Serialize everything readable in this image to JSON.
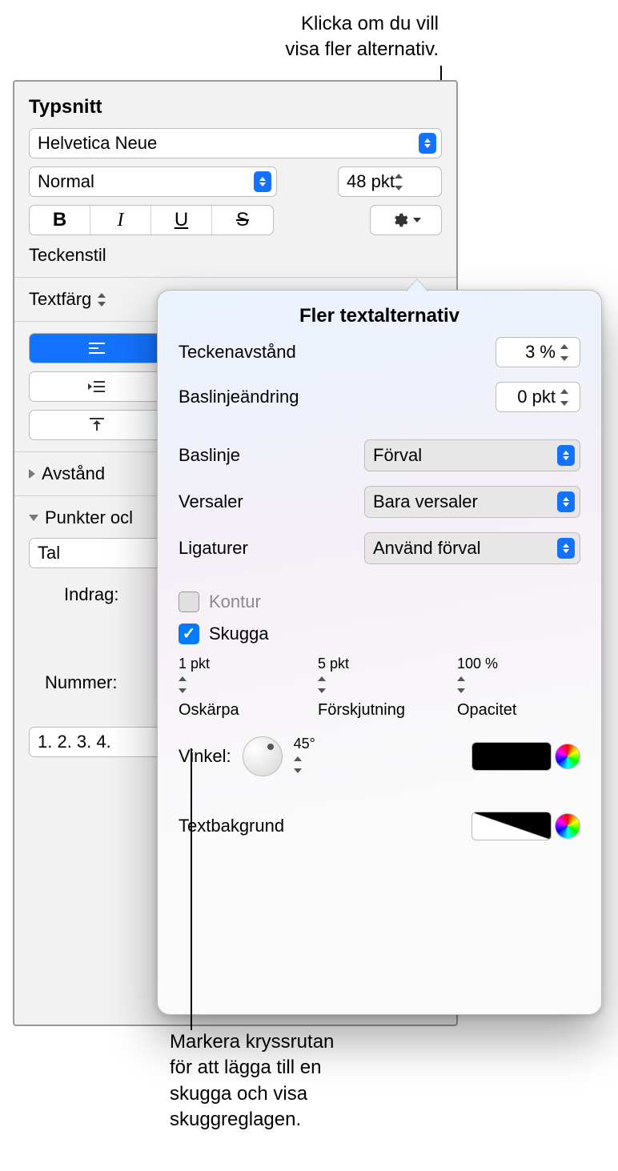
{
  "callouts": {
    "top": "Klicka om du vill\nvisa fler alternativ.",
    "bottom": "Markera kryssrutan\nför att lägga till en\nskugga och visa\nskuggreglagen."
  },
  "font": {
    "section_title": "Typsnitt",
    "family": "Helvetica Neue",
    "typeface": "Normal",
    "size": "48 pkt",
    "style_buttons": {
      "bold": "B",
      "italic": "I",
      "underline": "U",
      "strike": "S"
    }
  },
  "sidebar": {
    "char_style_label": "Teckenstil",
    "text_color_label": "Textfärg",
    "spacing_label": "Avstånd",
    "bullets_label": "Punkter ocl",
    "list_type": "Tal",
    "indent_label": "Indrag:",
    "number_label": "Nummer:",
    "list_format": "1. 2. 3. 4."
  },
  "popover": {
    "title": "Fler textalternativ",
    "char_spacing_label": "Teckenavstånd",
    "char_spacing_value": "3 %",
    "baseline_shift_label": "Baslinjeändring",
    "baseline_shift_value": "0 pkt",
    "baseline_label": "Baslinje",
    "baseline_value": "Förval",
    "caps_label": "Versaler",
    "caps_value": "Bara versaler",
    "ligatures_label": "Ligaturer",
    "ligatures_value": "Använd förval",
    "outline_label": "Kontur",
    "shadow_label": "Skugga",
    "blur_value": "1 pkt",
    "blur_label": "Oskärpa",
    "offset_value": "5 pkt",
    "offset_label": "Förskjutning",
    "opacity_value": "100 %",
    "opacity_label": "Opacitet",
    "angle_label": "Vinkel:",
    "angle_value": "45°",
    "text_bg_label": "Textbakgrund"
  }
}
